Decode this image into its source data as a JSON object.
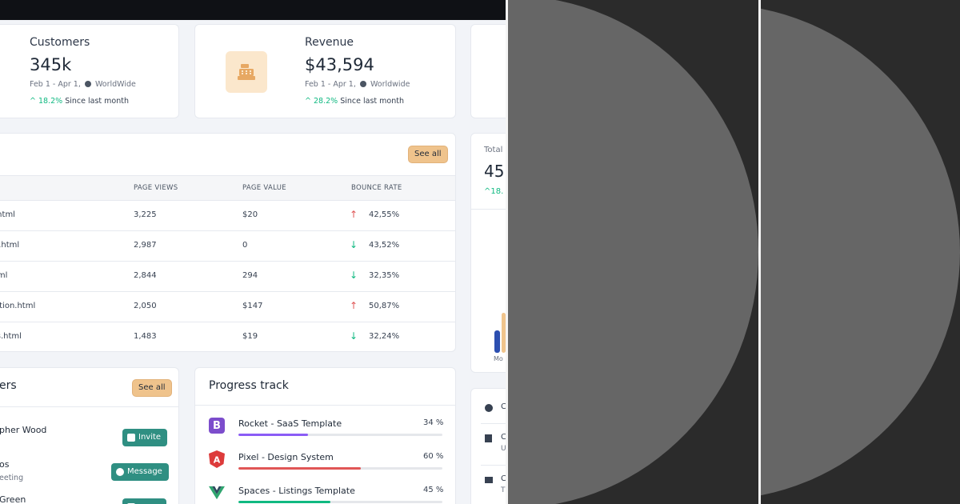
{
  "stats": [
    {
      "title": "Customers",
      "value": "345k",
      "range_prefix": "Feb 1 - Apr 1,",
      "range_region": "WorldWide",
      "change": "18.2%",
      "change_label": "Since last month"
    },
    {
      "title": "Revenue",
      "value": "$43,594",
      "range_prefix": "Feb 1 - Apr 1,",
      "range_region": "Worldwide",
      "change": "28.2%",
      "change_label": "Since last month"
    }
  ],
  "pages_table": {
    "see_all": "See all",
    "columns": [
      "PAGE VIEWS",
      "PAGE VALUE",
      "BOUNCE RATE"
    ],
    "rows": [
      {
        "page": ".html",
        "views": "3,225",
        "value": "$20",
        "bounce": "42,55%",
        "trend": "up"
      },
      {
        "page": "s.html",
        "views": "2,987",
        "value": "0",
        "bounce": "43,52%",
        "trend": "down"
      },
      {
        "page": "tml",
        "views": "2,844",
        "value": "294",
        "bounce": "32,35%",
        "trend": "down"
      },
      {
        "page": "ation.html",
        "views": "2,050",
        "value": "$147",
        "bounce": "50,87%",
        "trend": "up"
      },
      {
        "page": "ls.html",
        "views": "1,483",
        "value": "$19",
        "bounce": "32,24%",
        "trend": "down"
      }
    ]
  },
  "team": {
    "title": "ers",
    "see_all": "See all",
    "members": [
      {
        "name": "pher Wood",
        "sub": "",
        "action": "Invite"
      },
      {
        "name": "os",
        "sub": "eeting",
        "action": "Message"
      },
      {
        "name": "Green",
        "sub": "",
        "action": ""
      }
    ]
  },
  "progress": {
    "title": "Progress track",
    "items": [
      {
        "name": "Rocket - SaaS Template",
        "percent": 34,
        "percent_label": "34 %",
        "color": "#8b5cf6",
        "logo": "B",
        "logo_color": "#7c4dcc"
      },
      {
        "name": "Pixel - Design System",
        "percent": 60,
        "percent_label": "60 %",
        "color": "#e05656",
        "logo": "A",
        "logo_color": "#dd3b3b"
      },
      {
        "name": "Spaces - Listings Template",
        "percent": 45,
        "percent_label": "45 %",
        "color": "#10b981",
        "logo": "V",
        "logo_color": "#2fa56f"
      }
    ]
  },
  "sales_partial": {
    "label": "Total",
    "value": "45",
    "change": "18.",
    "axis_label": "Mo"
  },
  "colors": {
    "accent_up": "#10b981",
    "accent_down": "#e05656",
    "button_teal": "#2f8f82",
    "button_peach": "#efc38c"
  }
}
